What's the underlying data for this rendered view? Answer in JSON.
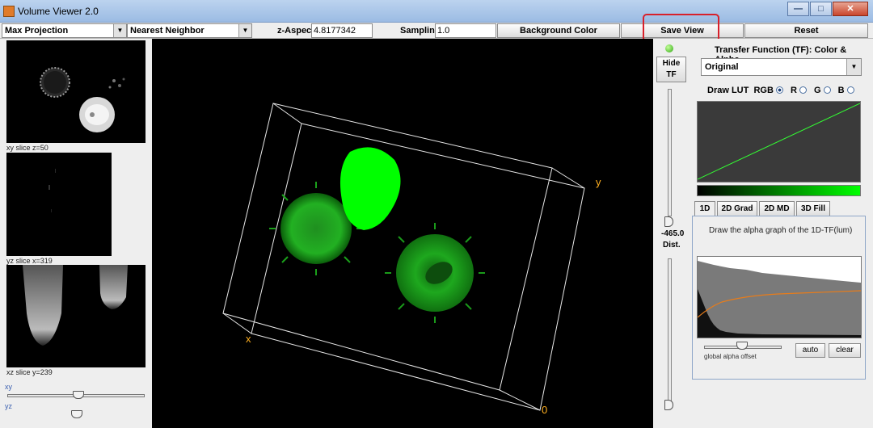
{
  "window": {
    "title": "Volume Viewer 2.0",
    "buttons": {
      "minimize": "—",
      "maximize": "□",
      "close": "✕"
    }
  },
  "toolbar": {
    "projection": "Max Projection",
    "interpolation": "Nearest Neighbor",
    "z_aspect_label": "z-Aspect:",
    "z_aspect_value": "4.8177342",
    "sampling_label": "Sampling:",
    "sampling_value": "1.0",
    "background_color": "Background Color",
    "save_view": "Save View",
    "reset": "Reset"
  },
  "slices": {
    "xy_label": "xy slice  z=50",
    "yz_label": "yz slice  x=319",
    "xz_label": "xz slice  y=239",
    "xy_slider_label": "xy",
    "yz_slider_label": "yz",
    "xy_slider_level": 0.52
  },
  "viewer": {
    "axis_x": "x",
    "axis_y": "y",
    "axis_origin": "0",
    "accent_color": "#00ff00",
    "axis_color": "#ffb020"
  },
  "right": {
    "hide_tf_line1": "Hide",
    "hide_tf_line2": "TF",
    "dist_value": "-465.0",
    "dist_label": "Dist.",
    "tf_title": "Transfer Function (TF): Color & Alpha",
    "tf_mode": "Original",
    "draw_lut": "Draw LUT",
    "rgb": "RGB",
    "r": "R",
    "g": "G",
    "b": "B",
    "tabs": [
      "1D",
      "2D Grad",
      "2D MD",
      "3D Fill"
    ],
    "tab_desc": "Draw the alpha graph of the 1D-TF(lum)",
    "global_alpha_offset": "global alpha offset",
    "auto": "auto",
    "clear": "clear"
  }
}
